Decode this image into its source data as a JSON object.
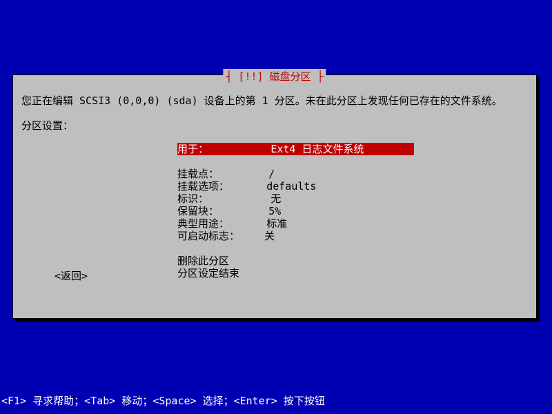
{
  "title": "┤ [!!] 磁盘分区 ├",
  "intro_text": "您正在编辑 SCSI3 (0,0,0) (sda) 设备上的第 1 分区。未在此分区上发现任何已存在的文件系统。",
  "settings_label": "分区设置：",
  "rows": {
    "use_as": {
      "label": "用于：",
      "value": "Ext4 日志文件系统"
    },
    "mount_point": {
      "label": "挂载点：",
      "value": "/"
    },
    "mount_options": {
      "label": "挂载选项：",
      "value": "defaults"
    },
    "label_field": {
      "label": "标识：",
      "value": "无"
    },
    "reserved": {
      "label": "保留块：",
      "value": "5%"
    },
    "usage": {
      "label": "典型用途：",
      "value": "标准"
    },
    "bootable": {
      "label": "可启动标志：",
      "value": "关"
    }
  },
  "actions": {
    "delete": "删除此分区",
    "done": "分区设定结束"
  },
  "back": "<返回>",
  "help_line": "<F1> 寻求帮助；<Tab> 移动；<Space> 选择；<Enter> 按下按钮"
}
